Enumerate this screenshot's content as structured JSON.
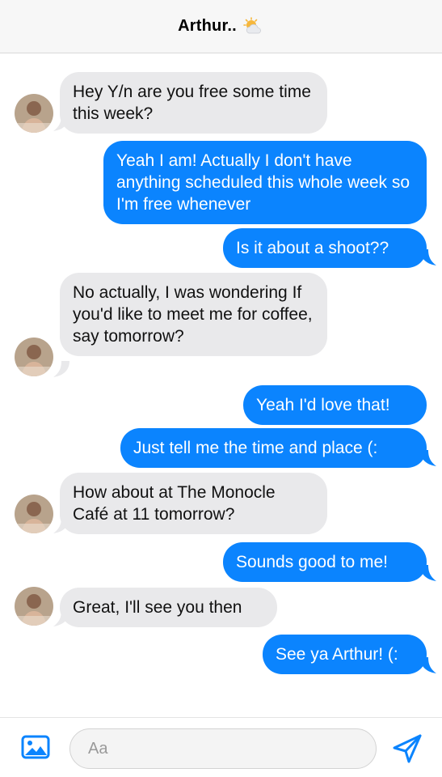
{
  "header": {
    "title": "Arthur..",
    "status_icon": "sun-behind-cloud-icon"
  },
  "messages": [
    {
      "sender": "Arthur",
      "direction": "incoming",
      "text": "Hey Y/n are you free some time this week?"
    },
    {
      "sender": "me",
      "direction": "outgoing",
      "text": "Yeah I am! Actually I don't have anything scheduled this whole week so I'm free whenever"
    },
    {
      "sender": "me",
      "direction": "outgoing",
      "text": "Is it about a shoot??"
    },
    {
      "sender": "Arthur",
      "direction": "incoming",
      "text": "No actually, I was wondering If you'd like to meet me for coffee, say tomorrow?"
    },
    {
      "sender": "me",
      "direction": "outgoing",
      "text": "Yeah I'd love that!"
    },
    {
      "sender": "me",
      "direction": "outgoing",
      "text": "Just tell me the time and place (:"
    },
    {
      "sender": "Arthur",
      "direction": "incoming",
      "text": "How about at The Monocle Café at 11 tomorrow?"
    },
    {
      "sender": "me",
      "direction": "outgoing",
      "text": "Sounds good to me!"
    },
    {
      "sender": "Arthur",
      "direction": "incoming",
      "text": "Great, I'll see you then"
    },
    {
      "sender": "me",
      "direction": "outgoing",
      "text": "See ya Arthur! (:"
    }
  ],
  "composer": {
    "placeholder": "Aa",
    "photo_icon": "photo-icon",
    "send_icon": "send-icon"
  },
  "colors": {
    "outgoing_bubble": "#0b84fe",
    "incoming_bubble": "#e9e9eb",
    "accent": "#0b84fe"
  }
}
